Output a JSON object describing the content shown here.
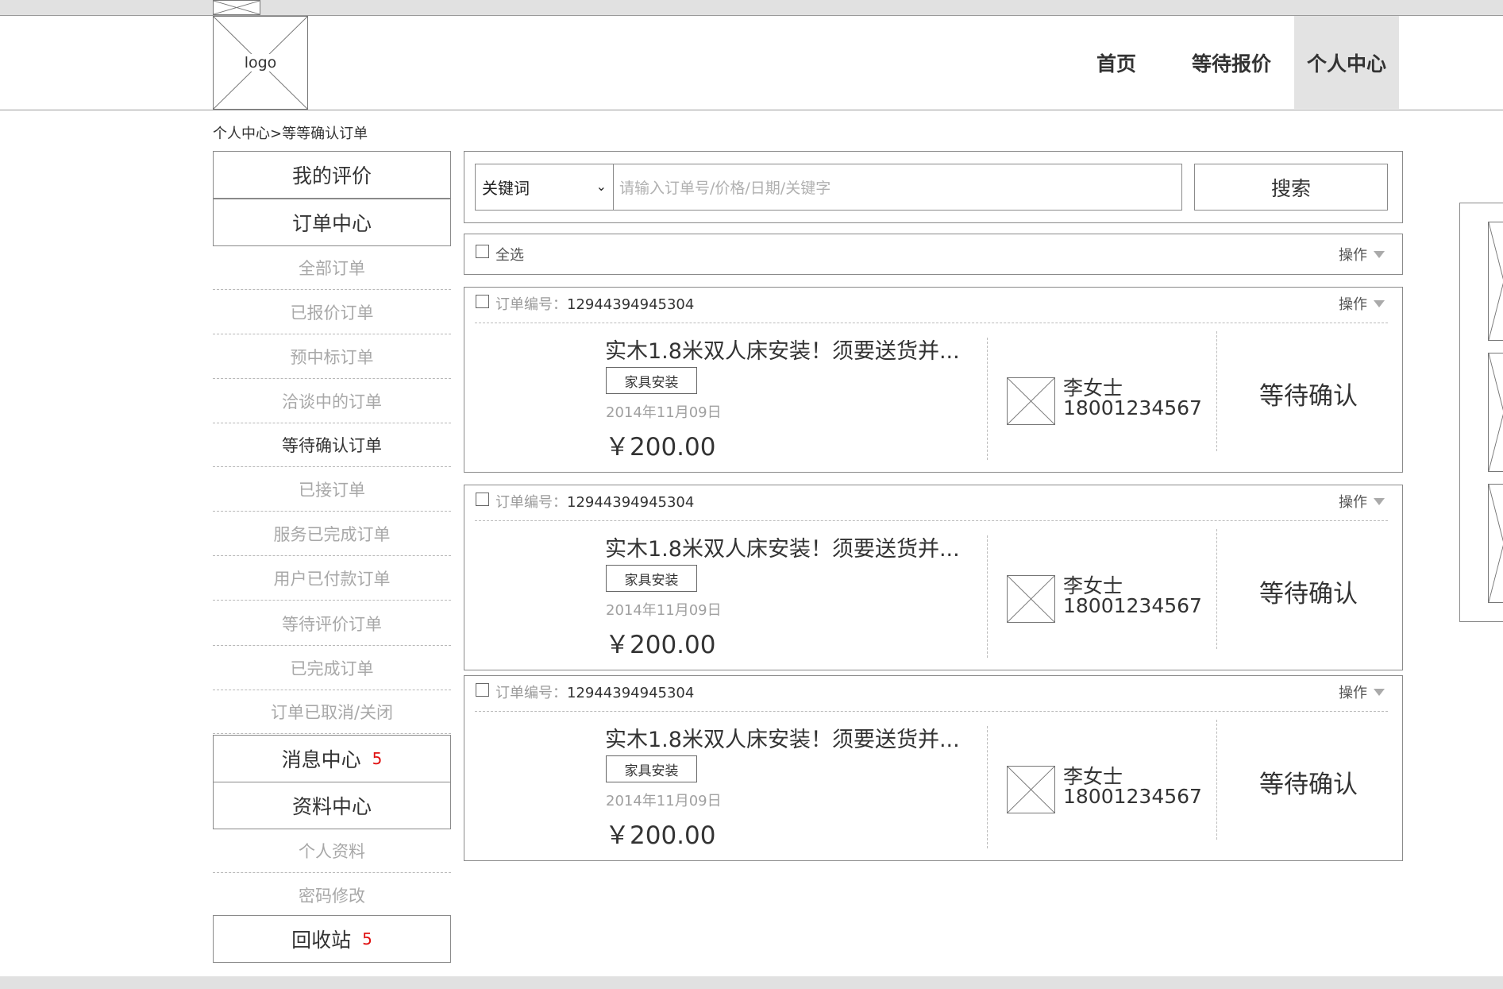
{
  "header": {
    "logo_label": "logo",
    "nav": [
      {
        "label": "首页"
      },
      {
        "label": "等待报价"
      },
      {
        "label": "个人中心"
      }
    ]
  },
  "breadcrumb": "个人中心>等等确认订单",
  "sidebar": {
    "my_reviews": "我的评价",
    "order_center": "订单中心",
    "order_items": [
      {
        "label": "全部订单"
      },
      {
        "label": "已报价订单"
      },
      {
        "label": "预中标订单"
      },
      {
        "label": "洽谈中的订单"
      },
      {
        "label": "等待确认订单"
      },
      {
        "label": "已接订单"
      },
      {
        "label": "服务已完成订单"
      },
      {
        "label": "用户已付款订单"
      },
      {
        "label": "等待评价订单"
      },
      {
        "label": "已完成订单"
      },
      {
        "label": "订单已取消/关闭"
      }
    ],
    "message_center": {
      "label": "消息中心",
      "badge": "5"
    },
    "profile_center": "资料中心",
    "profile_items": [
      {
        "label": "个人资料"
      },
      {
        "label": "密码修改"
      }
    ],
    "recycle_bin": {
      "label": "回收站",
      "badge": "5"
    }
  },
  "search": {
    "select_value": "关键词",
    "placeholder": "请输入订单号/价格/日期/关键字",
    "button_label": "搜索"
  },
  "select_all": {
    "label": "全选",
    "op_label": "操作"
  },
  "orders": [
    {
      "order_no_label": "订单编号：",
      "order_no": "12944394945304",
      "op_label": "操作",
      "title": "实木1.8米双人床安装！须要送货并...",
      "tag": "家具安装",
      "date": "2014年11月09日",
      "price": "￥200.00",
      "customer_name": "李女士",
      "customer_phone": "18001234567",
      "status": "等待确认"
    },
    {
      "order_no_label": "订单编号：",
      "order_no": "12944394945304",
      "op_label": "操作",
      "title": "实木1.8米双人床安装！须要送货并...",
      "tag": "家具安装",
      "date": "2014年11月09日",
      "price": "￥200.00",
      "customer_name": "李女士",
      "customer_phone": "18001234567",
      "status": "等待确认"
    },
    {
      "order_no_label": "订单编号：",
      "order_no": "12944394945304",
      "op_label": "操作",
      "title": "实木1.8米双人床安装！须要送货并...",
      "tag": "家具安装",
      "date": "2014年11月09日",
      "price": "￥200.00",
      "customer_name": "李女士",
      "customer_phone": "18001234567",
      "status": "等待确认"
    }
  ],
  "colors": {
    "badge": "#e01010",
    "active_nav_bg": "#e3e3e3",
    "muted_text": "#a8a8a8"
  }
}
